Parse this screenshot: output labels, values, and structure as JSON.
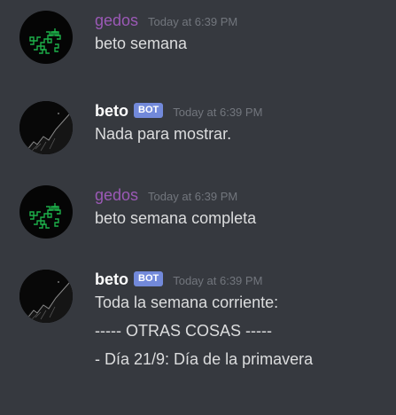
{
  "messages": [
    {
      "author": "gedos",
      "is_bot": false,
      "timestamp": "Today at 6:39 PM",
      "lines": [
        "beto semana"
      ]
    },
    {
      "author": "beto",
      "is_bot": true,
      "bot_tag": "BOT",
      "timestamp": "Today at 6:39 PM",
      "lines": [
        "Nada para mostrar."
      ]
    },
    {
      "author": "gedos",
      "is_bot": false,
      "timestamp": "Today at 6:39 PM",
      "lines": [
        "beto semana completa"
      ]
    },
    {
      "author": "beto",
      "is_bot": true,
      "bot_tag": "BOT",
      "timestamp": "Today at 6:39 PM",
      "lines": [
        "Toda la semana corriente:",
        "----- OTRAS COSAS -----",
        "- Día 21/9: Día de la primavera"
      ]
    }
  ],
  "colors": {
    "background": "#36393f",
    "gedos_name": "#9b59b6",
    "bot_tag": "#7289da",
    "timestamp": "#72767d",
    "text": "#dcddde"
  }
}
